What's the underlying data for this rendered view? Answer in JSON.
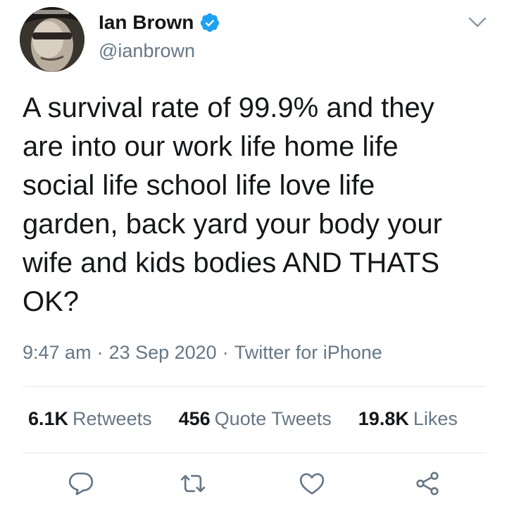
{
  "author": {
    "display_name": "Ian Brown",
    "handle": "@ianbrown",
    "verified": true
  },
  "tweet": {
    "text": "A survival rate of 99.9% and they\nare into our work life home life\nsocial life school life love life\ngarden, back yard your body your\nwife and kids bodies AND THATS\nOK?",
    "time": "9:47 am",
    "date": "23 Sep 2020",
    "source": "Twitter for iPhone"
  },
  "stats": {
    "retweets_count": "6.1K",
    "retweets_label": "Retweets",
    "quotes_count": "456",
    "quotes_label": "Quote Tweets",
    "likes_count": "19.8K",
    "likes_label": "Likes"
  },
  "icons": {
    "verified": "verified-badge-icon",
    "caret": "chevron-down-icon",
    "reply": "reply-icon",
    "retweet": "retweet-icon",
    "like": "heart-icon",
    "share": "share-icon"
  },
  "colors": {
    "text_primary": "#14171a",
    "text_secondary": "#657786",
    "verified_blue": "#1da1f2",
    "divider": "#e1e8ed",
    "icon_gray": "#657786"
  }
}
